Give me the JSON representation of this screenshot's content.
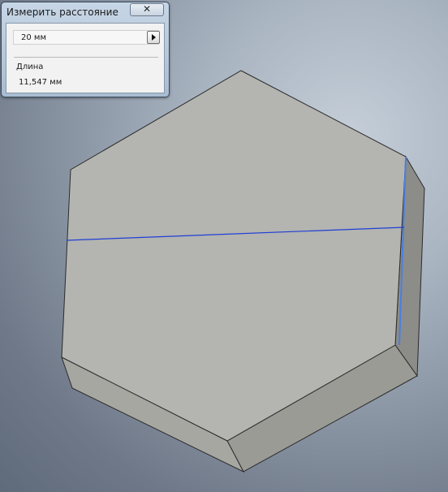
{
  "dialog": {
    "title": "Измерить расстояние",
    "close_label": "✕",
    "distance_value": "20 мм",
    "length_label": "Длина",
    "length_value": "11,547 мм"
  },
  "colors": {
    "top_face": "#b4b4b0",
    "side_face_front": "#a2a29d",
    "side_face_right": "#8c8c88",
    "edge_outline": "#2b2b2b",
    "measure_line": "#1f3fd6",
    "highlight_edge": "#4a7fe0"
  },
  "icons": {
    "close": "close-icon",
    "expand": "chevron-right-icon"
  }
}
